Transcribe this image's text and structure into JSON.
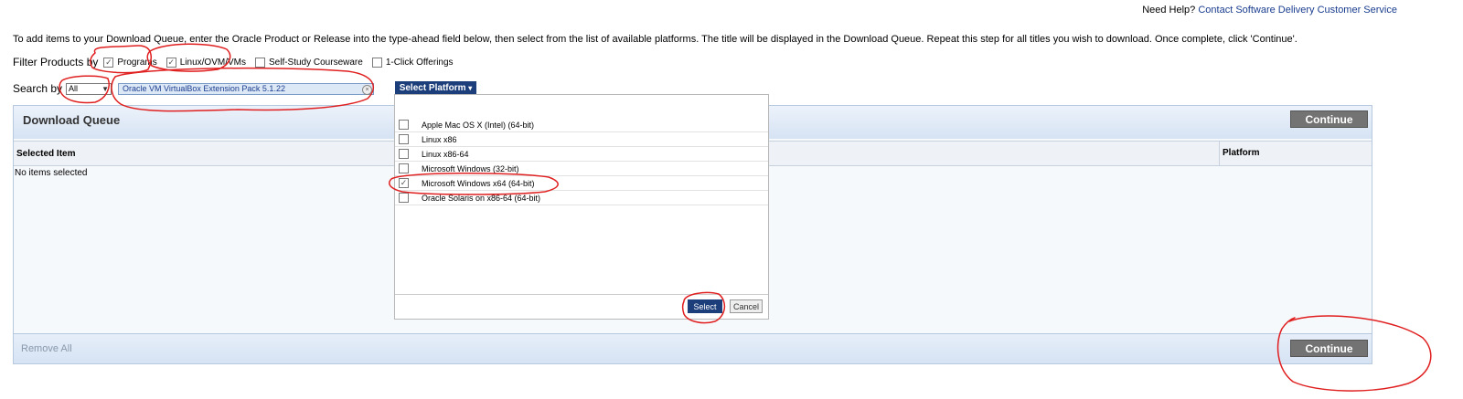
{
  "help": {
    "prefix": "Need Help?",
    "link": "Contact Software Delivery Customer Service"
  },
  "instructions": "To add items to your Download Queue, enter the Oracle Product or Release into the type-ahead field below, then select from the list of available platforms. The title will be displayed in the Download Queue. Repeat this step for all titles you wish to download. Once complete, click 'Continue'.",
  "filter": {
    "label": "Filter Products by",
    "options": [
      {
        "label": "Programs",
        "checked": true
      },
      {
        "label": "Linux/OVM/VMs",
        "checked": true
      },
      {
        "label": "Self-Study Courseware",
        "checked": false
      },
      {
        "label": "1-Click Offerings",
        "checked": false
      }
    ]
  },
  "search": {
    "label": "Search by",
    "type_value": "All",
    "product_value": "Oracle VM VirtualBox Extension Pack 5.1.22"
  },
  "platform_button": "Select Platform",
  "platform_popup": {
    "items": [
      {
        "label": "Apple Mac OS X (Intel) (64-bit)",
        "checked": false
      },
      {
        "label": "Linux x86",
        "checked": false
      },
      {
        "label": "Linux x86-64",
        "checked": false
      },
      {
        "label": "Microsoft Windows (32-bit)",
        "checked": false
      },
      {
        "label": "Microsoft Windows x64 (64-bit)",
        "checked": true
      },
      {
        "label": "Oracle Solaris on x86-64 (64-bit)",
        "checked": false
      }
    ],
    "select_label": "Select",
    "cancel_label": "Cancel"
  },
  "queue": {
    "title": "Download Queue",
    "continue_label": "Continue",
    "col_selected": "Selected Item",
    "col_platform": "Platform",
    "empty_text": "No items selected",
    "remove_all": "Remove All"
  },
  "colors": {
    "accent": "#1c3e7a",
    "annotation": "#e02020",
    "continue": "#737373"
  }
}
